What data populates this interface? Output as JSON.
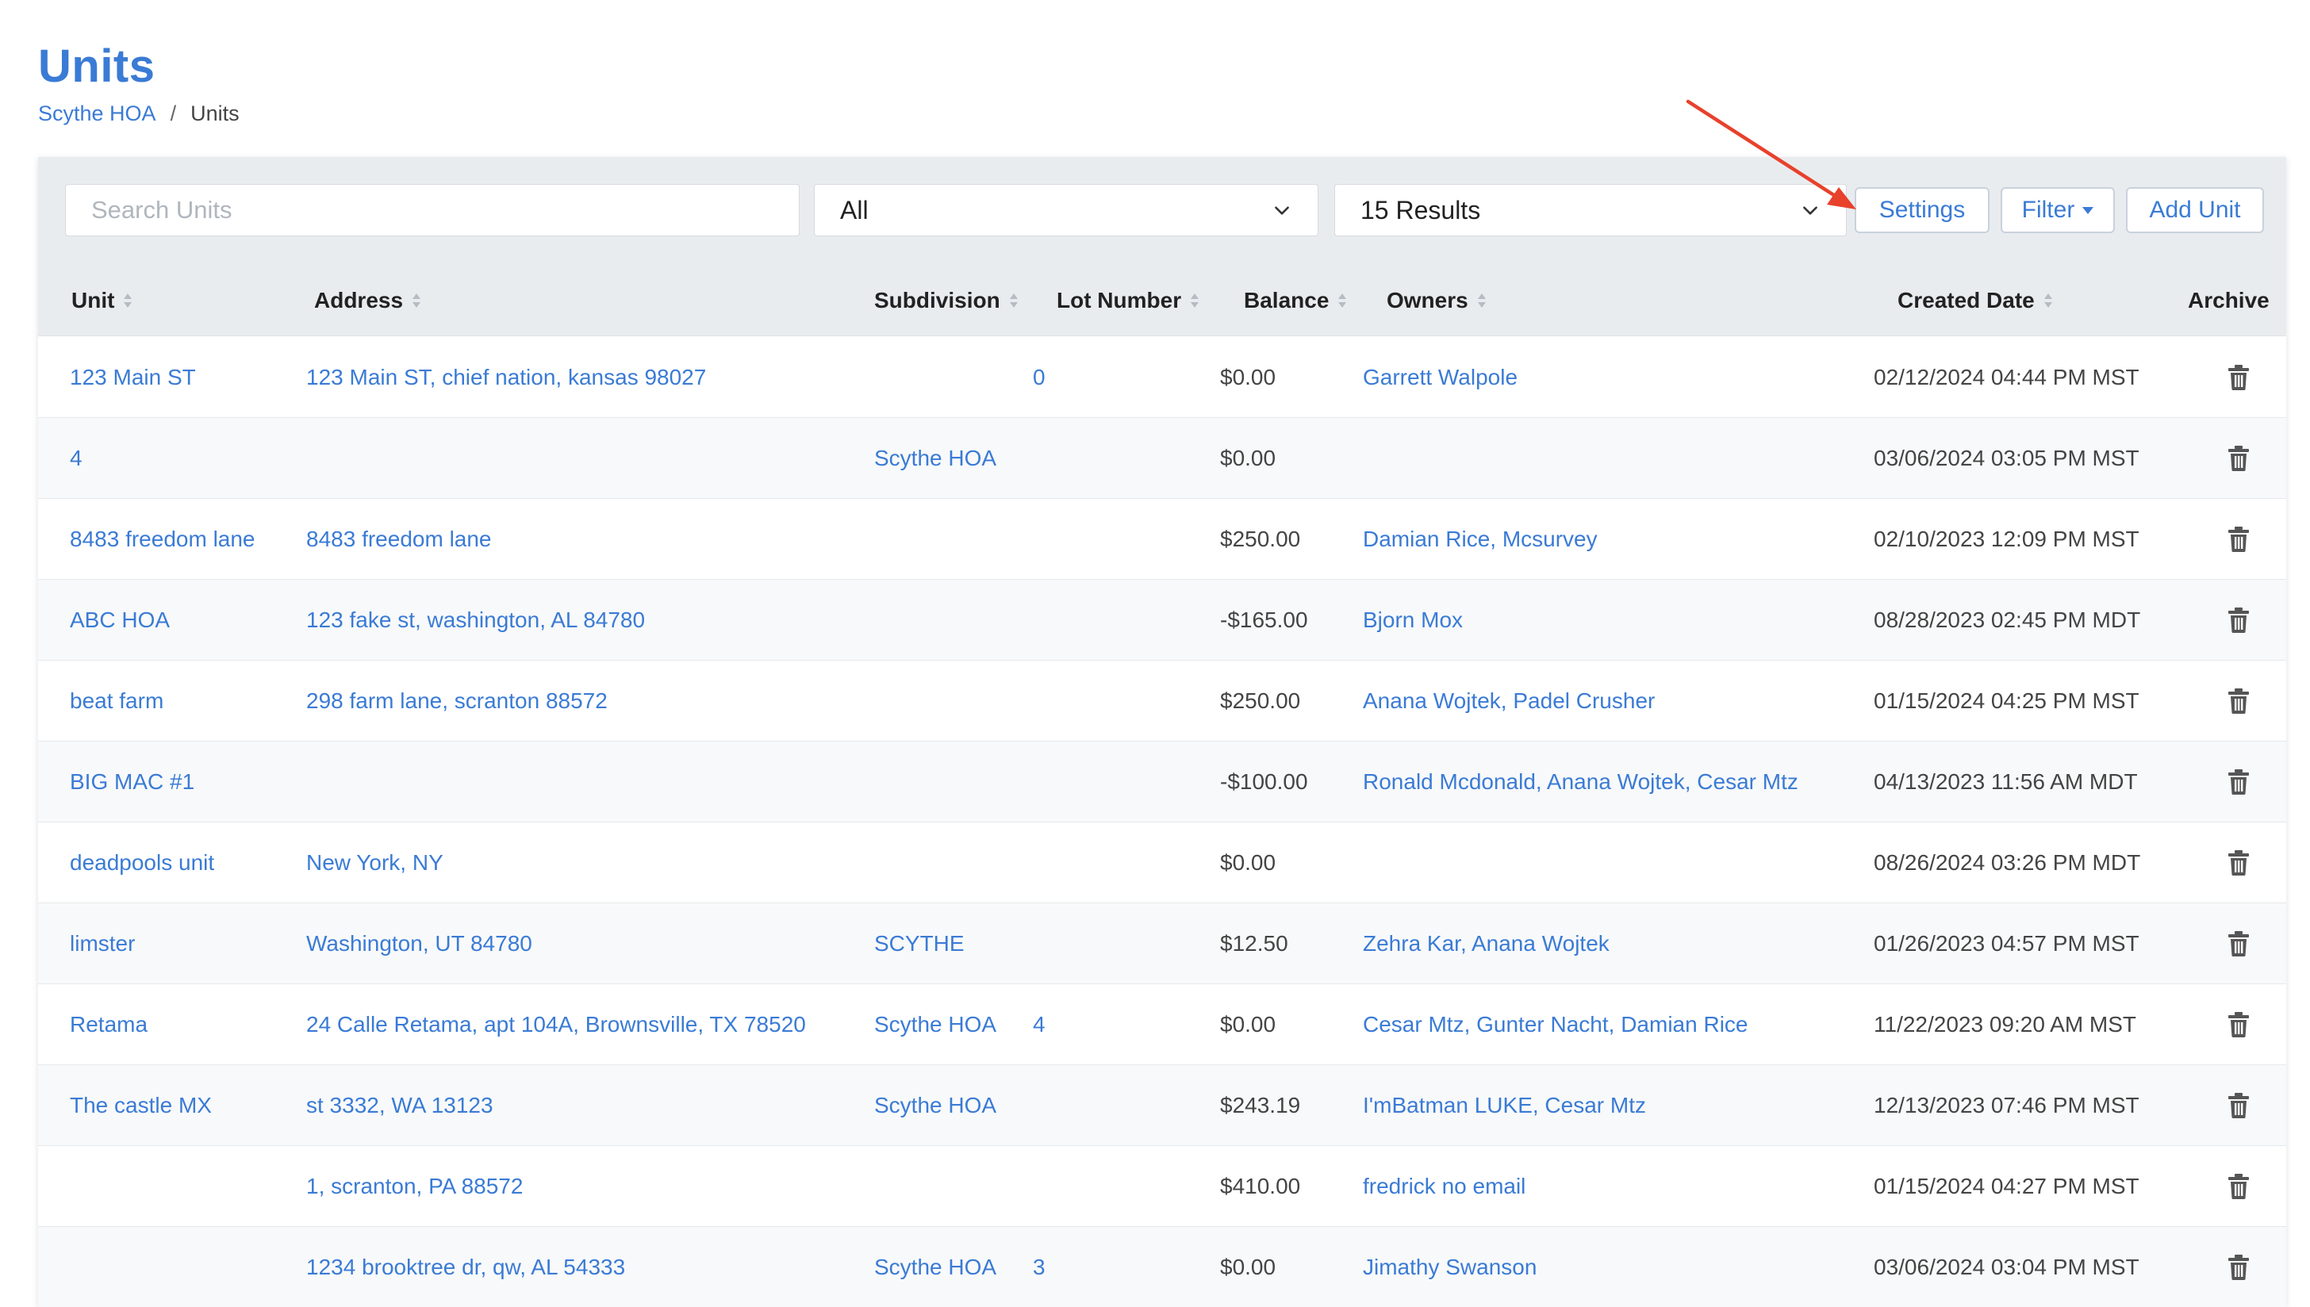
{
  "page": {
    "title": "Units",
    "breadcrumb": {
      "parent": "Scythe HOA",
      "separator": "/",
      "current": "Units"
    }
  },
  "toolbar": {
    "search_placeholder": "Search Units",
    "status_filter": "All",
    "results_select": "15 Results",
    "settings_label": "Settings",
    "filter_label": "Filter",
    "add_label": "Add Unit"
  },
  "table": {
    "headers": {
      "unit": "Unit",
      "address": "Address",
      "subdivision": "Subdivision",
      "lot": "Lot Number",
      "balance": "Balance",
      "owners": "Owners",
      "created": "Created Date",
      "archive": "Archive"
    },
    "rows": [
      {
        "unit": "123 Main ST",
        "address": "123 Main ST, chief nation, kansas 98027",
        "subdivision": "",
        "lot": "0",
        "balance": "$0.00",
        "owners": "Garrett Walpole",
        "created": "02/12/2024 04:44 PM MST"
      },
      {
        "unit": "4",
        "address": "",
        "subdivision": "Scythe HOA",
        "lot": "",
        "balance": "$0.00",
        "owners": "",
        "created": "03/06/2024 03:05 PM MST"
      },
      {
        "unit": "8483 freedom lane",
        "address": "8483 freedom lane",
        "subdivision": "",
        "lot": "",
        "balance": "$250.00",
        "owners": "Damian Rice, Mcsurvey",
        "created": "02/10/2023 12:09 PM MST"
      },
      {
        "unit": "ABC HOA",
        "address": "123 fake st, washington, AL 84780",
        "subdivision": "",
        "lot": "",
        "balance": "-$165.00",
        "owners": "Bjorn Mox",
        "created": "08/28/2023 02:45 PM MDT"
      },
      {
        "unit": "beat farm",
        "address": "298 farm lane, scranton 88572",
        "subdivision": "",
        "lot": "",
        "balance": "$250.00",
        "owners": "Anana Wojtek, Padel Crusher",
        "created": "01/15/2024 04:25 PM MST"
      },
      {
        "unit": "BIG MAC #1",
        "address": "",
        "subdivision": "",
        "lot": "",
        "balance": "-$100.00",
        "owners": "Ronald Mcdonald, Anana Wojtek, Cesar Mtz",
        "created": "04/13/2023 11:56 AM MDT"
      },
      {
        "unit": "deadpools unit",
        "address": "New York, NY",
        "subdivision": "",
        "lot": "",
        "balance": "$0.00",
        "owners": "",
        "created": "08/26/2024 03:26 PM MDT"
      },
      {
        "unit": "limster",
        "address": "Washington, UT 84780",
        "subdivision": "SCYTHE",
        "lot": "",
        "balance": "$12.50",
        "owners": "Zehra Kar, Anana Wojtek",
        "created": "01/26/2023 04:57 PM MST"
      },
      {
        "unit": "Retama",
        "address": "24 Calle Retama, apt 104A, Brownsville, TX 78520",
        "subdivision": "Scythe HOA",
        "lot": "4",
        "balance": "$0.00",
        "owners": "Cesar Mtz, Gunter Nacht, Damian Rice",
        "created": "11/22/2023 09:20 AM MST"
      },
      {
        "unit": "The castle MX",
        "address": "st 3332, WA 13123",
        "subdivision": "Scythe HOA",
        "lot": "",
        "balance": "$243.19",
        "owners": "I'mBatman LUKE, Cesar Mtz",
        "created": "12/13/2023 07:46 PM MST"
      },
      {
        "unit": "",
        "address": "1, scranton, PA 88572",
        "subdivision": "",
        "lot": "",
        "balance": "$410.00",
        "owners": "fredrick no email",
        "created": "01/15/2024 04:27 PM MST"
      },
      {
        "unit": "",
        "address": "1234 brooktree dr, qw, AL 54333",
        "subdivision": "Scythe HOA",
        "lot": "3",
        "balance": "$0.00",
        "owners": "Jimathy Swanson",
        "created": "03/06/2024 03:04 PM MST"
      }
    ]
  },
  "colors": {
    "accent": "#3a7bd5",
    "annotation_arrow": "#e8412c"
  },
  "icons": {
    "sort": "sort-icon",
    "archive": "trash-icon",
    "dropdown": "chevron-down-icon"
  }
}
